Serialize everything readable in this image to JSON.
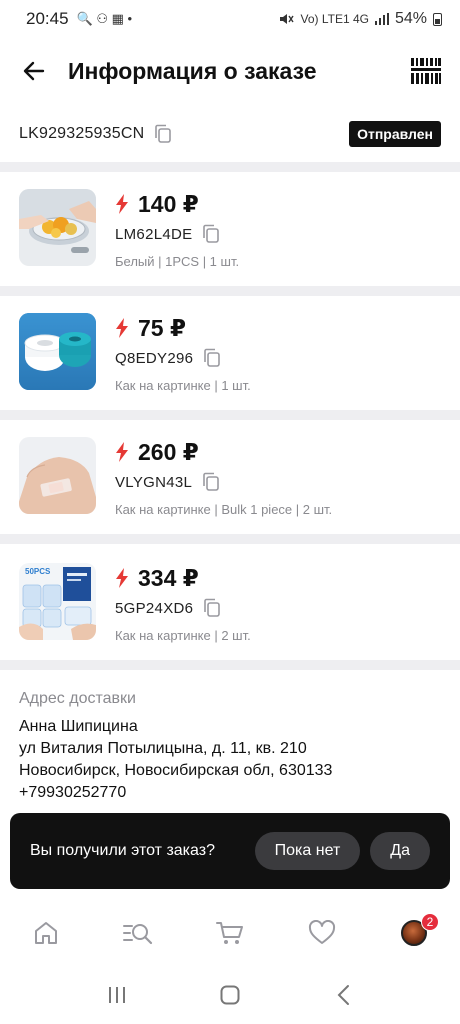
{
  "status_bar": {
    "time": "20:45",
    "left_icons": "🔍 ⚇ ▦ •",
    "network": "Vo) LTE1 4G",
    "battery": "54%"
  },
  "header": {
    "title": "Информация о заказе",
    "icons": {
      "back": "arrow-left-icon",
      "barcode": "barcode-icon"
    }
  },
  "tracking": {
    "number": "LK929325935CN",
    "status": "Отправлен"
  },
  "products": [
    {
      "price": "140 ₽",
      "sku": "LM62L4DE",
      "variant": "Белый | 1PCS | 1 шт.",
      "thumb": "colander-fruit"
    },
    {
      "price": "75 ₽",
      "sku": "Q8EDY296",
      "variant": "Как на картинке | 1 шт.",
      "thumb": "tape-roll"
    },
    {
      "price": "260 ₽",
      "sku": "VLYGN43L",
      "variant": "Как на картинке | Bulk 1 piece | 2 шт.",
      "thumb": "hand-plaster"
    },
    {
      "price": "334 ₽",
      "sku": "5GP24XD6",
      "variant": "Как на картинке | 2 шт.",
      "thumb": "plaster-pack",
      "thumb_label": "50PCS"
    }
  ],
  "address": {
    "label": "Адрес доставки",
    "name": "Анна Шипицина",
    "street": "ул Виталия Потылицына, д. 11, кв. 210",
    "city": "Новосибирск, Новосибирская обл, 630133",
    "phone": "+79930252770"
  },
  "prompt": {
    "question": "Вы получили этот заказ?",
    "no_label": "Пока нет",
    "yes_label": "Да"
  },
  "bottom_nav": {
    "items": [
      "home-icon",
      "search-catalog-icon",
      "cart-icon",
      "heart-icon",
      "avatar"
    ],
    "profile_badge": "2"
  },
  "colors": {
    "accent_bolt": "#e53935",
    "badge": "#e52d3c",
    "divider": "#eeeef1",
    "muted_text": "#8a8a8f"
  }
}
